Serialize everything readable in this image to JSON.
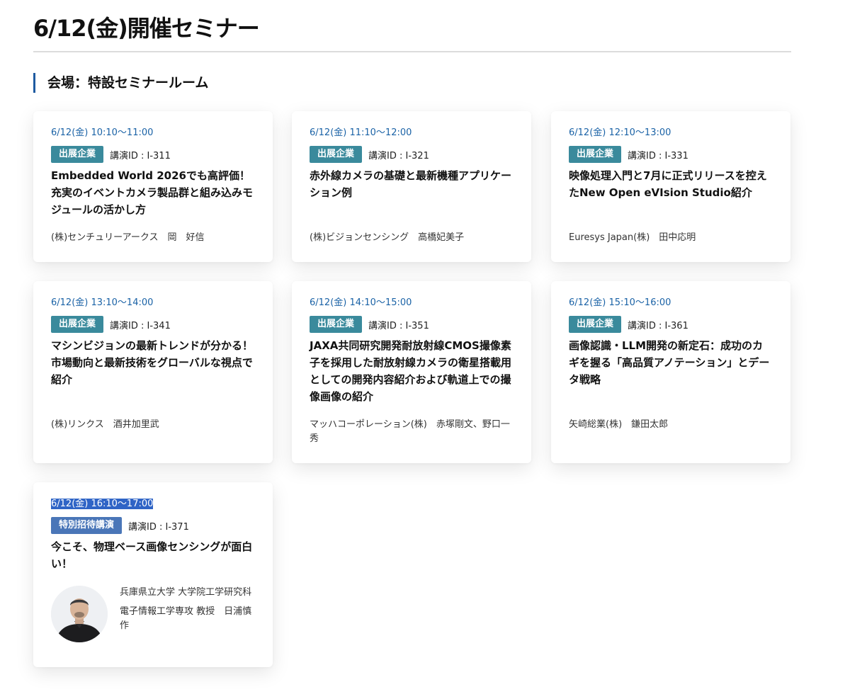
{
  "page": {
    "title": "6/12(金)開催セミナー"
  },
  "venue": {
    "heading": "会場：特設セミナールーム"
  },
  "sessions": [
    {
      "time": "6/12(金) 10:10〜11:00",
      "badge": "出展企業",
      "lecture_id": "講演ID : I-311",
      "title": "Embedded World 2026でも高評価！充実のイベントカメラ製品群と組み込みモジュールの活かし方",
      "speaker": "(株)センチュリーアークス　岡　好信"
    },
    {
      "time": "6/12(金) 11:10〜12:00",
      "badge": "出展企業",
      "lecture_id": "講演ID : I-321",
      "title": "赤外線カメラの基礎と最新機種アプリケーション例",
      "speaker": "(株)ビジョンセンシング　高橋妃美子"
    },
    {
      "time": "6/12(金) 12:10〜13:00",
      "badge": "出展企業",
      "lecture_id": "講演ID : I-331",
      "title": "映像処理入門と7月に正式リリースを控えたNew Open eVIsion Studio紹介",
      "speaker": "Euresys Japan(株)　田中応明"
    },
    {
      "time": "6/12(金) 13:10〜14:00",
      "badge": "出展企業",
      "lecture_id": "講演ID : I-341",
      "title": "マシンビジョンの最新トレンドが分かる！\n市場動向と最新技術をグローバルな視点で紹介",
      "speaker": "(株)リンクス　酒井加里武"
    },
    {
      "time": "6/12(金) 14:10〜15:00",
      "badge": "出展企業",
      "lecture_id": "講演ID : I-351",
      "title": "JAXA共同研究開発耐放射線CMOS撮像素子を採用した耐放射線カメラの衛星搭載用としての開発内容紹介および軌道上での撮像画像の紹介",
      "speaker": "マッハコーポレーション(株)　赤塚剛文、野口一秀"
    },
    {
      "time": "6/12(金) 15:10〜16:00",
      "badge": "出展企業",
      "lecture_id": "講演ID : I-361",
      "title": "画像認識・LLM開発の新定石：成功のカギを握る「高品質アノテーション」とデータ戦略",
      "speaker": "矢崎総業(株)　鎌田太郎"
    },
    {
      "time": "6/12(金) 16:10〜17:00",
      "badge": "特別招待講演",
      "lecture_id": "講演ID : I-371",
      "title": "今こそ、物理ベース画像センシングが面白い！",
      "speaker_affiliation": "兵庫県立大学 大学院工学研究科",
      "speaker_detail": "電子情報工学専攻 教授　日浦慎作"
    }
  ],
  "colors": {
    "accent": "#1e5aa0",
    "time_text": "#1a62a6",
    "badge_exhibitor": "#3a8a9c",
    "badge_special": "#4a76b8"
  }
}
